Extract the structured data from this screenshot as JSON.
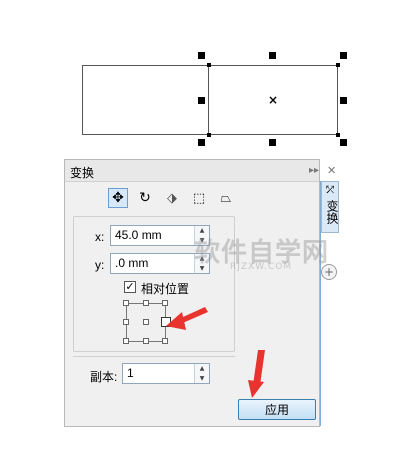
{
  "docker": {
    "title": "变换",
    "collapse_glyph": "▸▸",
    "close_glyph": "✕",
    "tools": [
      {
        "name": "position-tool-icon",
        "glyph": "✥"
      },
      {
        "name": "rotate-tool-icon",
        "glyph": "↻"
      },
      {
        "name": "scale-mirror-tool-icon",
        "glyph": "⬗"
      },
      {
        "name": "size-tool-icon",
        "glyph": "⬚"
      },
      {
        "name": "skew-tool-icon",
        "glyph": "⏢"
      }
    ],
    "x_label": "x:",
    "x_value": "45.0 mm",
    "y_label": "y:",
    "y_value": ".0 mm",
    "relative_position_label": "相对位置",
    "relative_position_checked": "✓",
    "copies_label": "副本:",
    "copies_value": "1",
    "apply_label": "应用"
  },
  "side_tab": {
    "label": "变换",
    "add_glyph": "+"
  },
  "canvas": {
    "center_mark": "×"
  },
  "watermark": {
    "big": "软件自学网",
    "small": "RJZXW.COM"
  },
  "colors": {
    "arrow": "#e8332e",
    "accent": "#3c7fb1"
  }
}
